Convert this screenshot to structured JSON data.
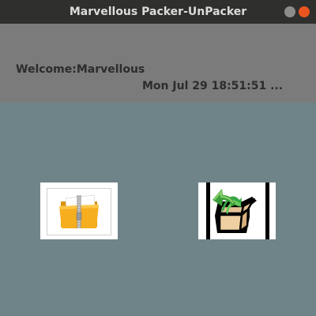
{
  "window": {
    "title": "Marvellous Packer-UnPacker",
    "controls": [
      "minimize",
      "close"
    ]
  },
  "header": {
    "welcome": "Welcome:Marvellous",
    "datetime": "Mon Jul 29 18:51:51 ..."
  },
  "actions": [
    {
      "name": "pack",
      "icon": "zipped-folder-icon"
    },
    {
      "name": "unpack",
      "icon": "unpack-box-icon"
    }
  ],
  "colors": {
    "titlebar": "#2f2f2d",
    "header": "#7b7b7b",
    "body": "#6f8489",
    "close": "#e9541f"
  }
}
